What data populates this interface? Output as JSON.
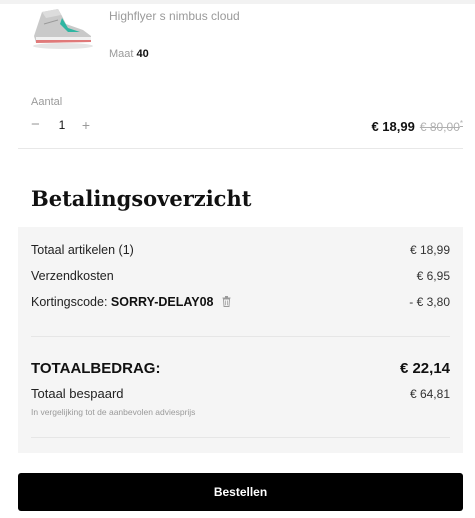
{
  "product": {
    "name": "Highflyer s nimbus cloud",
    "size_label": "Maat",
    "size_value": "40",
    "quantity_label": "Aantal",
    "minus_symbol": "−",
    "quantity": "1",
    "plus_symbol": "+",
    "price": "€ 18,99",
    "old_price": "€ 80,00",
    "old_price_marker": "*"
  },
  "summary": {
    "title": "Betalingsoverzicht",
    "items_label": "Totaal artikelen (1)",
    "items_value": "€ 18,99",
    "shipping_label": "Verzendkosten",
    "shipping_value": "€ 6,95",
    "discount_label": "Kortingscode:",
    "discount_code": "SORRY-DELAY08",
    "discount_value": "- € 3,80",
    "total_label": "TOTAALBEDRAG:",
    "total_value": "€ 22,14",
    "saved_label": "Totaal bespaard",
    "saved_value": "€ 64,81",
    "saved_note": "In vergelijking tot de aanbevolen adviesprijs"
  },
  "actions": {
    "order_label": "Bestellen"
  },
  "icons": {
    "product_image": "sneaker-image",
    "remove_code": "trash-icon"
  },
  "colors": {
    "button_bg": "#000000",
    "summary_bg": "#f5f5f5",
    "muted_text": "#9a9a9a"
  }
}
